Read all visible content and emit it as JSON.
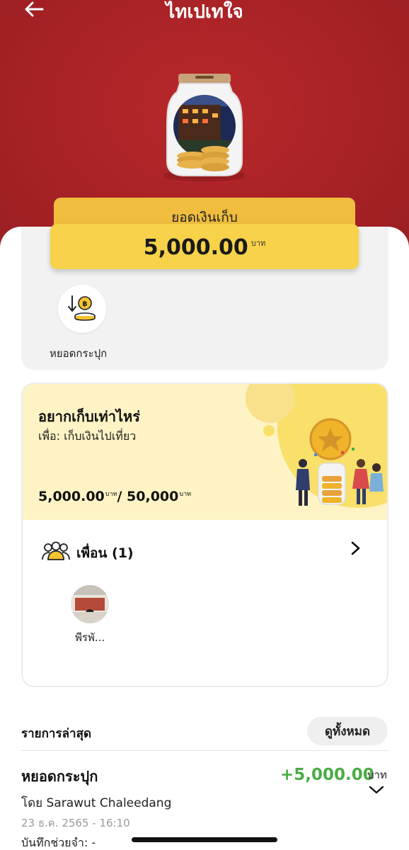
{
  "header": {
    "title": "ไทเปเทใจ",
    "back_icon": "arrow-left-icon"
  },
  "balance": {
    "label": "ยอดเงินเก็บ",
    "amount": "5,000.00",
    "unit": "บาท"
  },
  "actions": {
    "drop_label": "หยอดกระปุก",
    "drop_icon": "coin-deposit-icon"
  },
  "goal": {
    "title": "อยากเก็บเท่าไหร่",
    "purpose": "เพื่อ: เก็บเงินไปเที่ยว",
    "saved": "5,000.00",
    "saved_unit": "บาท",
    "separator": "/ ",
    "target": "50,000",
    "target_unit": "บาท",
    "progress_fraction": 0.1
  },
  "friends": {
    "label": "เพื่อน (1)",
    "members": [
      {
        "name": "พีรพั..."
      }
    ]
  },
  "recent": {
    "title": "รายการล่าสุด",
    "see_all_label": "ดูทั้งหมด",
    "transactions": [
      {
        "title": "หยอดกระปุก",
        "amount": "+5,000.00",
        "unit": "บาท",
        "by": "โดย Sarawut Chaleedang",
        "time": "23 ธ.ค. 2565 - 16:10",
        "note": "บันทึกช่วยจำ: -"
      }
    ]
  },
  "colors": {
    "header_red": "#a72226",
    "banner_yellow": "#f7d24a",
    "banner_top_yellow": "#f0bd3e",
    "goal_bg": "#fdf3c4",
    "positive_green": "#4aac45"
  }
}
